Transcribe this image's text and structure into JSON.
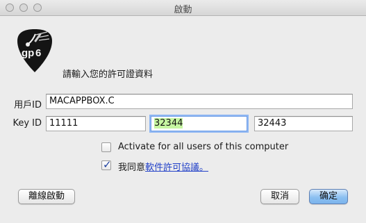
{
  "window": {
    "title": "啟動"
  },
  "prompt": "請輸入您的許可證資料",
  "logo": {
    "text": "gp6"
  },
  "user_id": {
    "label": "用戶ID",
    "value": "MACAPPBOX.C"
  },
  "key_id": {
    "label": "Key ID",
    "parts": [
      "11111",
      "32344",
      "32443"
    ]
  },
  "options": {
    "all_users": {
      "label": "Activate for all users of this computer",
      "checked": false
    },
    "agree": {
      "prefix": "我同意",
      "link": "軟件許可協議。",
      "checked": true
    }
  },
  "buttons": {
    "offline": "離線啟動",
    "cancel": "取消",
    "ok": "确定"
  }
}
